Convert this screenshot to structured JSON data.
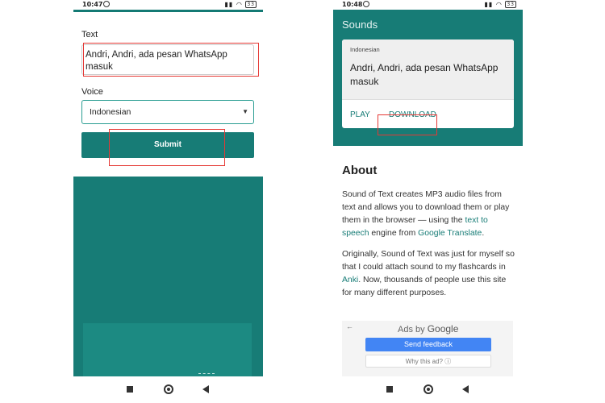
{
  "left_phone": {
    "status": {
      "time": "10:47",
      "battery": "33"
    },
    "form": {
      "text_label": "Text",
      "text_value": "Andri, Andri, ada pesan WhatsApp masuk",
      "voice_label": "Voice",
      "voice_value": "Indonesian",
      "submit_label": "Submit"
    }
  },
  "right_phone": {
    "status": {
      "time": "10:48",
      "battery": "33"
    },
    "sounds_title": "Sounds",
    "card": {
      "language": "Indonesian",
      "text": "Andri, Andri, ada pesan WhatsApp masuk",
      "play_label": "PLAY",
      "download_label": "DOWNLOAD"
    },
    "about": {
      "title": "About",
      "p1_a": "Sound of Text creates MP3 audio files from text and allows you to download them or play them in the browser — using the ",
      "p1_link1": "text to speech",
      "p1_b": " engine from ",
      "p1_link2": "Google Translate",
      "p1_c": ".",
      "p2_a": "Originally, Sound of Text was just for myself so that I could attach sound to my flashcards in ",
      "p2_link": "Anki",
      "p2_b": ". Now, thousands of people use this site for many different purposes."
    },
    "ad": {
      "ads_by": "Ads by",
      "google": "Google",
      "send_feedback": "Send feedback",
      "why_this_ad": "Why this ad? ⓘ"
    }
  },
  "colors": {
    "teal": "#177c76",
    "highlight": "#e53935",
    "ad_blue": "#4285f4"
  }
}
